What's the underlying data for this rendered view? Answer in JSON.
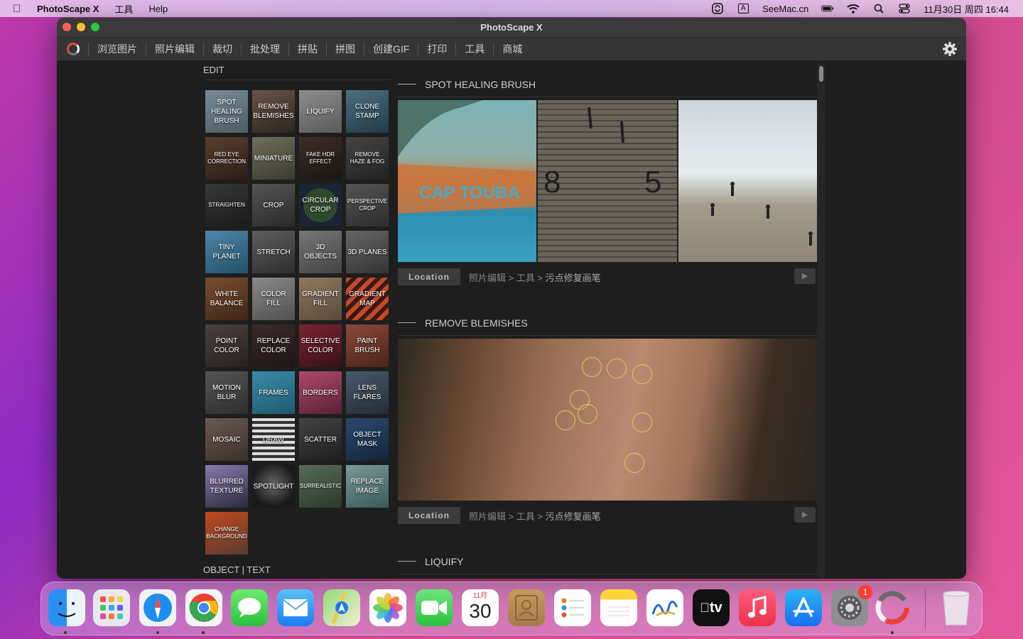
{
  "menubar": {
    "app_name": "PhotoScape X",
    "items": [
      "工具",
      "Help"
    ],
    "status": {
      "site": "SeeMac.cn",
      "input_badge": "A",
      "datetime": "11月30日 周四  16:44"
    }
  },
  "window": {
    "title": "PhotoScape X",
    "nav": [
      "浏览图片",
      "照片编辑",
      "裁切",
      "批处理",
      "拼贴",
      "拼图",
      "创建GIF",
      "打印",
      "工具",
      "商城"
    ]
  },
  "left": {
    "section_label": "EDIT",
    "bottom_label": "OBJECT | TEXT",
    "tiles": [
      "SPOT HEALING BRUSH",
      "REMOVE BLEMISHES",
      "LIQUIFY",
      "CLONE STAMP",
      "RED EYE CORRECTION",
      "MINIATURE",
      "FAKE HDR EFFECT",
      "REMOVE HAZE & FOG",
      "STRAIGHTEN",
      "CROP",
      "CIRCULAR CROP",
      "PERSPECTIVE CROP",
      "TINY PLANET",
      "STRETCH",
      "3D OBJECTS",
      "3D PLANES",
      "WHITE BALANCE",
      "COLOR FILL",
      "GRADIENT FILL",
      "GRADIENT MAP",
      "POINT COLOR",
      "REPLACE COLOR",
      "SELECTIVE COLOR",
      "PAINT BRUSH",
      "MOTION BLUR",
      "FRAMES",
      "BORDERS",
      "LENS FLARES",
      "MOSAIC",
      "DRAW",
      "SCATTER",
      "OBJECT MASK",
      "BLURRED TEXTURE",
      "SPOTLIGHT",
      "SURREALISTIC",
      "REPLACE IMAGE",
      "CHANGE BACKGROUND"
    ]
  },
  "right": {
    "sections": [
      {
        "title": "SPOT HEALING BRUSH",
        "location_label": "Location",
        "path_prefix": "照片编辑 > 工具 > ",
        "path_last": "污点修复画笔",
        "boat_text": "CAP TOUBA",
        "wall_numbers": [
          "8",
          "5"
        ]
      },
      {
        "title": "REMOVE BLEMISHES",
        "location_label": "Location",
        "path_prefix": "照片编辑 > 工具 > ",
        "path_last": "污点修复画笔"
      },
      {
        "title": "LIQUIFY"
      }
    ]
  },
  "dock": {
    "calendar_month": "11月",
    "calendar_day": "30",
    "tv_label": "tv",
    "settings_badge": "1",
    "apps": [
      "finder",
      "launchpad",
      "safari",
      "chrome",
      "messages",
      "mail",
      "maps",
      "photos",
      "facetime",
      "calendar",
      "contacts",
      "reminders",
      "notes",
      "freeform",
      "tv",
      "music",
      "app-store",
      "system-settings",
      "photoscape-x",
      "trash"
    ]
  }
}
